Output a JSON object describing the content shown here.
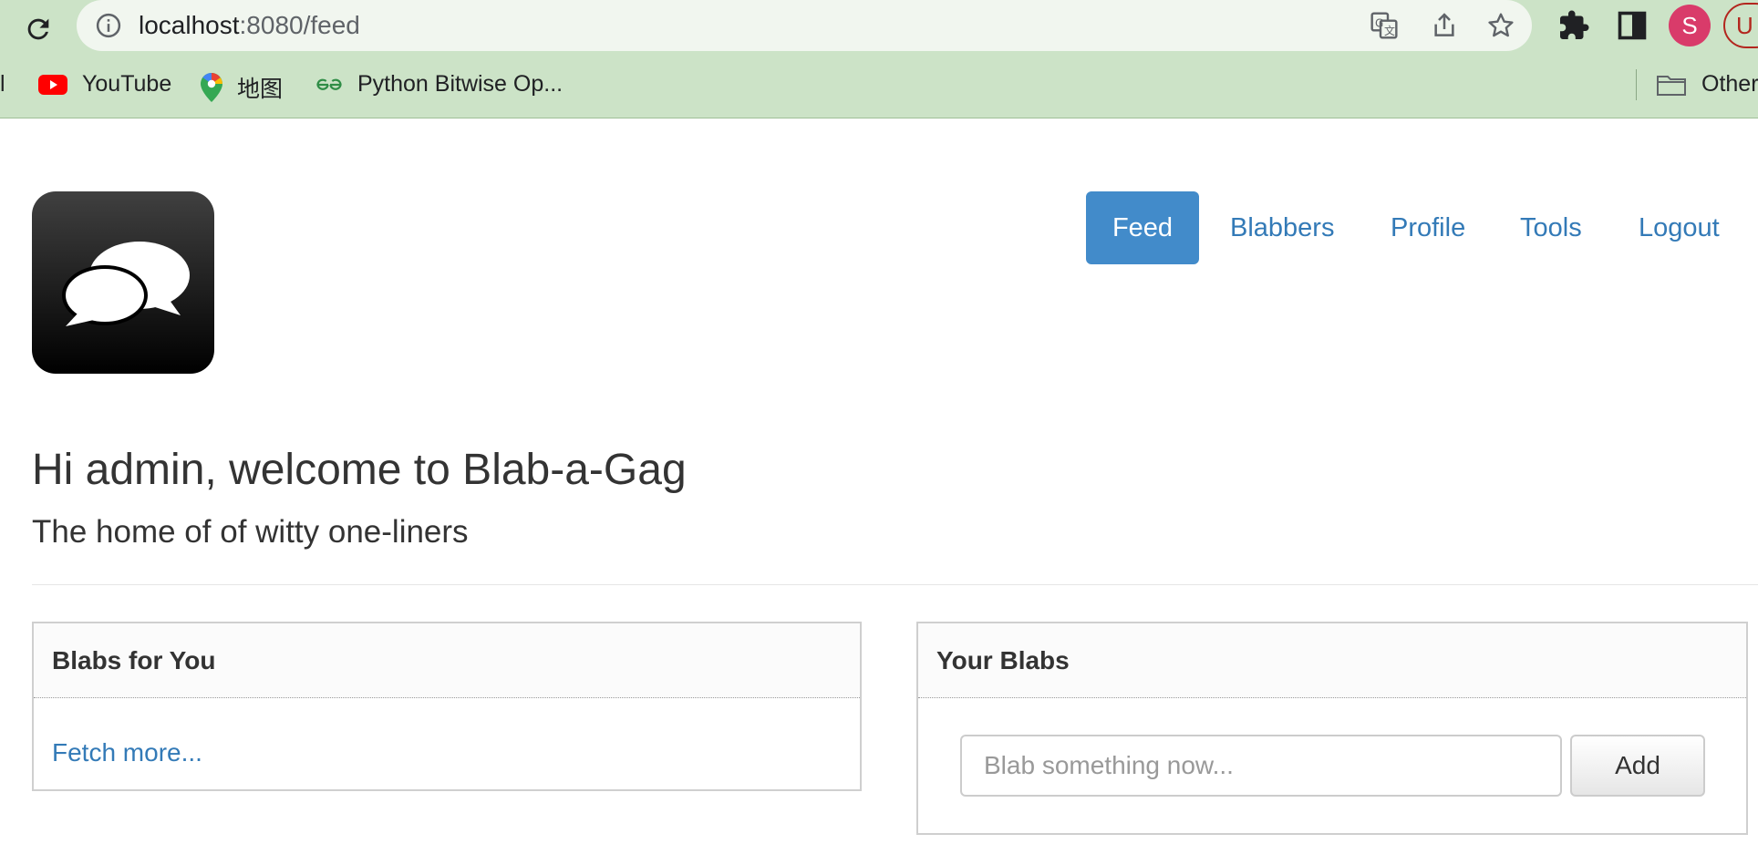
{
  "browser": {
    "url_host": "localhost",
    "url_rest": ":8080/feed",
    "profile_initial": "S",
    "partial_profile_initial": "U",
    "bookmarks": [
      {
        "label": "l",
        "icon": "truncated"
      },
      {
        "label": "YouTube",
        "icon": "youtube-icon"
      },
      {
        "label": "地图",
        "icon": "google-maps-icon"
      },
      {
        "label": "Python Bitwise Op...",
        "icon": "geeksforgeeks-icon"
      },
      {
        "label": "Other",
        "icon": "folder-icon"
      }
    ],
    "colors": {
      "toolbar": "#cce3c7",
      "omnibox": "#f1f6ef",
      "avatar": "#d93b6a"
    }
  },
  "nav": {
    "items": [
      "Feed",
      "Blabbers",
      "Profile",
      "Tools",
      "Logout"
    ],
    "active": "Feed",
    "colors": {
      "active_bg": "#428bca",
      "link": "#337ab7"
    }
  },
  "header": {
    "welcome": "Hi admin, welcome to Blab-a-Gag",
    "tagline": "The home of of witty one-liners"
  },
  "feed_panel": {
    "title": "Blabs for You",
    "fetch_more": "Fetch more..."
  },
  "your_blabs_panel": {
    "title": "Your Blabs",
    "input_placeholder": "Blab something now...",
    "add_label": "Add"
  }
}
